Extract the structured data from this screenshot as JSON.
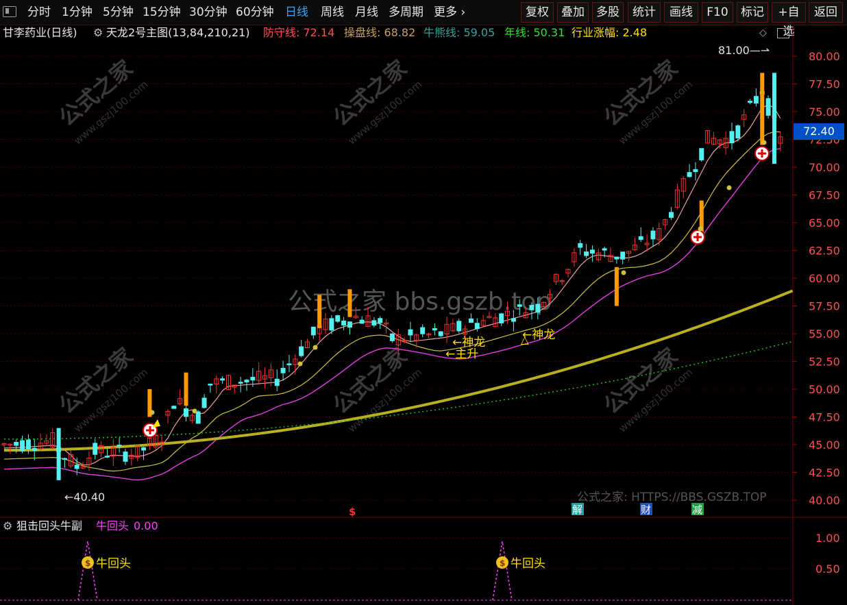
{
  "toolbar": {
    "periods": [
      {
        "label": "分时",
        "active": false
      },
      {
        "label": "1分钟",
        "active": false
      },
      {
        "label": "5分钟",
        "active": false
      },
      {
        "label": "15分钟",
        "active": false
      },
      {
        "label": "30分钟",
        "active": false
      },
      {
        "label": "60分钟",
        "active": false
      },
      {
        "label": "日线",
        "active": true
      },
      {
        "label": "周线",
        "active": false
      },
      {
        "label": "月线",
        "active": false
      },
      {
        "label": "多周期",
        "active": false
      },
      {
        "label": "更多",
        "active": false
      }
    ],
    "actions": [
      "复权",
      "叠加",
      "多股",
      "统计",
      "画线",
      "F10",
      "标记",
      "+自选",
      "返回"
    ]
  },
  "info": {
    "stock": "甘李药业(日线)",
    "indicator": "天龙2号主图(13,84,210,21)",
    "fields": [
      {
        "name": "防守线",
        "value": "72.14",
        "color": "#ff5050"
      },
      {
        "name": "操盘线",
        "value": "68.82",
        "color": "#c8a060"
      },
      {
        "name": "牛熊线",
        "value": "59.05",
        "color": "#3aa0a0"
      },
      {
        "name": "年线",
        "value": "50.31",
        "color": "#30e030"
      },
      {
        "name": "行业涨幅",
        "value": "2.48",
        "color": "#ffe000"
      }
    ]
  },
  "price_tag": "72.40",
  "y_axis": [
    "80.00",
    "77.50",
    "75.00",
    "72.50",
    "70.00",
    "67.50",
    "65.00",
    "62.50",
    "60.00",
    "57.50",
    "55.00",
    "52.50",
    "50.00",
    "47.50",
    "45.00",
    "42.50",
    "40.00"
  ],
  "annotations": {
    "high": "81.00",
    "low": "40.40",
    "labels": [
      "神龙",
      "主升",
      "神龙"
    ],
    "watermark_big": "公式之家 bbs.gszb.top",
    "watermark_small_cn": "公式之家",
    "watermark_small_url": "www.gszj100.com",
    "footer_mark": "公式之家: HTTPS://BBS.GSZB.TOP",
    "event_marks": [
      "$",
      "解",
      "财",
      "减"
    ]
  },
  "sub": {
    "title": "狙击回头牛副",
    "field_name": "牛回头",
    "field_value": "0.00",
    "signal_label": "牛回头",
    "y_axis": [
      "1.00",
      "0.50"
    ]
  },
  "colors": {
    "up": "#ff3030",
    "down": "#54f0f0",
    "up_fill": "#ff9a00",
    "grid": "#5a0000",
    "magenta": "#ff40ff"
  }
}
